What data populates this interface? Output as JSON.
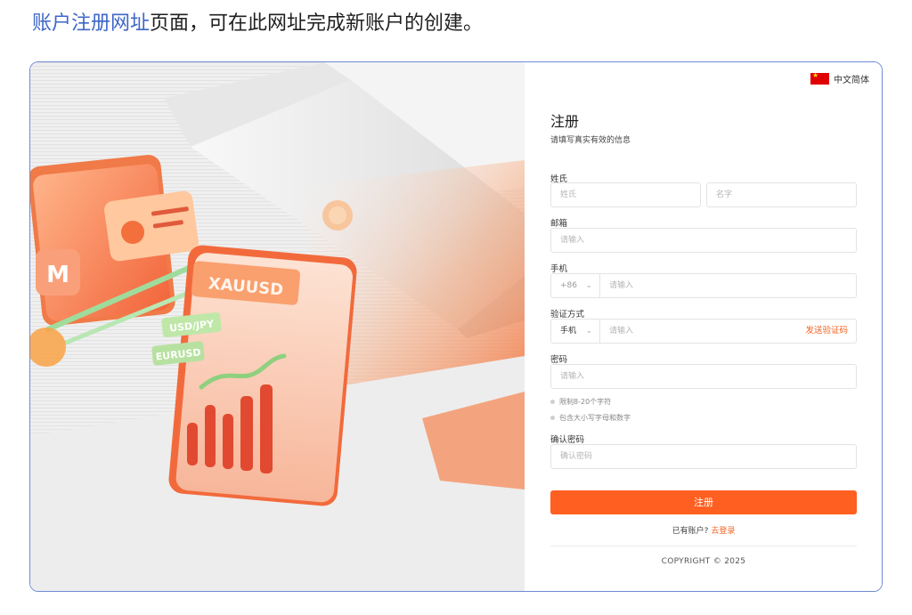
{
  "intro": {
    "link_text": "账户注册网址",
    "rest_text": "页面，可在此网址完成新账户的创建。"
  },
  "illustration": {
    "card_label": "XAUUSD",
    "tag_1": "USD/JPY",
    "tag_2": "EURUSD"
  },
  "language": {
    "label": "中文简体",
    "flag_icon": "cn-flag-icon"
  },
  "form": {
    "title": "注册",
    "subtitle": "请填写真实有效的信息",
    "name": {
      "label": "姓氏",
      "last_placeholder": "姓氏",
      "first_placeholder": "名字"
    },
    "email": {
      "label": "邮箱",
      "placeholder": "请输入"
    },
    "phone": {
      "label": "手机",
      "country_code": "+86",
      "placeholder": "请输入"
    },
    "verify": {
      "label": "验证方式",
      "method": "手机",
      "placeholder": "请输入",
      "send_code": "发送验证码"
    },
    "password": {
      "label": "密码",
      "placeholder": "请输入",
      "hints": [
        "限制8-20个字符",
        "包含大小写字母和数字"
      ]
    },
    "confirm": {
      "label": "确认密码",
      "placeholder": "确认密码"
    },
    "submit_label": "注册",
    "have_account": "已有账户?",
    "login_link": "去登录",
    "copyright": "COPYRIGHT © 2025"
  },
  "colors": {
    "accent": "#ff5f21",
    "link": "#3d67c8",
    "frame_border": "#6f8bd6"
  }
}
